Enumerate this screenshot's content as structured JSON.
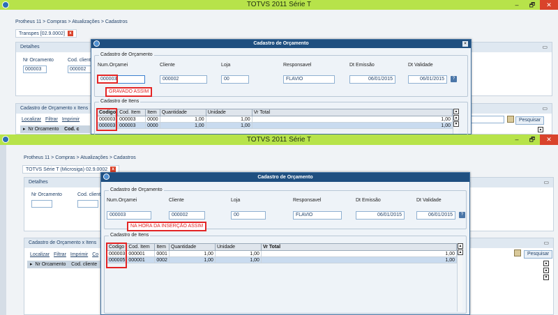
{
  "window": {
    "title": "TOTVS 2011 Série T",
    "minimize": "–",
    "maximize": "🗗",
    "close": "✕"
  },
  "top": {
    "breadcrumb": "Protheus 11 > Compras > Atualizações > Cadastros",
    "tab_label": "Transpes [02.9.0002]",
    "details": {
      "title": "Detalhes",
      "nr_label": "Nr Orcamento",
      "nr_value": "000003",
      "cod_label": "Cod. cliente",
      "cod_value": "000002"
    },
    "items_panel": {
      "title": "Cadastro de Orçamento x Itens",
      "links": [
        "Localizar",
        "Filtrar",
        "Imprimir"
      ],
      "col1": "Nr Orcamento",
      "col2": "Cod. c"
    },
    "search_button": "Pesquisar",
    "modal": {
      "title": "Cadastro de Orçamento",
      "group_header": "Cadastro de Orçamento",
      "labels": {
        "num": "Num.Orçamei",
        "cliente": "Cliente",
        "loja": "Loja",
        "resp": "Responsavel",
        "emissao": "Dt Emissão",
        "validade": "Dt Validade"
      },
      "values": {
        "num": "000003",
        "cliente": "000002",
        "loja": "00",
        "resp": "FLAVIO",
        "emissao": "06/01/2015",
        "validade": "06/01/2015"
      },
      "annotation": "GRAVADO ASSIM",
      "group_items": "Cadastro de Itens",
      "columns": [
        "Codigo",
        "Cod. Item",
        "Item",
        "Quantidade",
        "Unidade",
        "Vr Total"
      ],
      "rows": [
        [
          "000003",
          "000003",
          "0000",
          "1,00",
          "1,00",
          "1,00"
        ],
        [
          "000003",
          "000003",
          "0000",
          "1,00",
          "1,00",
          "1,00"
        ]
      ]
    }
  },
  "bottom": {
    "breadcrumb": "Protheus 11 > Compras > Atualizações > Cadastros",
    "tab_label": "TOTVS Série T  (Microsiga) 02.9.0002",
    "details": {
      "title": "Detalhes",
      "nr_label": "Nr Orcamento",
      "cod_label": "Cod. cliente"
    },
    "items_panel": {
      "title": "Cadastro de Orçamento x Itens",
      "links": [
        "Localizar",
        "Filtrar",
        "Imprimir",
        "Co"
      ],
      "col1": "Nr Orcamento",
      "col2": "Cod. cliente"
    },
    "search_button": "Pesquisar",
    "modal": {
      "title": "Cadastro de Orçamento",
      "group_header": "Cadastro de Orçamento",
      "labels": {
        "num": "Num.Orçamei",
        "cliente": "Cliente",
        "loja": "Loja",
        "resp": "Responsavel",
        "emissao": "Dt Emissão",
        "validade": "Dt Validade"
      },
      "values": {
        "num": "000003",
        "cliente": "000002",
        "loja": "00",
        "resp": "FLAVIO",
        "emissao": "06/01/2015",
        "validade": "06/01/2015"
      },
      "annotation": "NA HORA DA INSERÇÃO ASSIM",
      "group_items": "Cadastro de Itens",
      "columns": [
        "Codigo",
        "Cod. Item",
        "Item",
        "Quantidade",
        "Unidade",
        "Vr Total"
      ],
      "rows": [
        [
          "000003",
          "000001",
          "0001",
          "1,00",
          "1,00",
          "1,00"
        ],
        [
          "000005",
          "000001",
          "0002",
          "1,00",
          "1,00",
          "1,00"
        ]
      ]
    }
  }
}
